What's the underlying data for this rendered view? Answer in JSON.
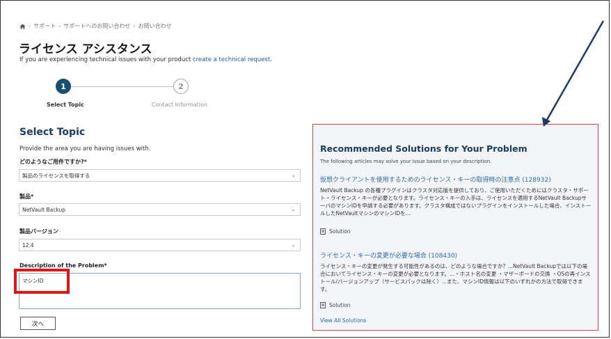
{
  "breadcrumb": {
    "home_icon": "home-icon",
    "items": [
      "サポート",
      "サポートへのお問い合わせ",
      "お問い合わせ"
    ],
    "separator": "›"
  },
  "page": {
    "title": "ライセンス アシスタンス",
    "subtitle_prefix": "If you are experiencing technical issues with your product ",
    "subtitle_link": "create a technical request",
    "subtitle_suffix": "."
  },
  "stepper": {
    "steps": [
      {
        "number": "1",
        "label": "Select Topic"
      },
      {
        "number": "2",
        "label": "Contact Information"
      }
    ]
  },
  "form": {
    "section_title": "Select Topic",
    "section_desc": "Provide the area you are having issues with.",
    "topic_label": "どのようなご用件ですか?*",
    "topic_value": "製品のライセンスを取得する",
    "product_label": "製品*",
    "product_value": "NetVault Backup",
    "version_label": "製品バージョン",
    "version_value": "12.4",
    "description_label": "Description of the Problem*",
    "description_value": "マシンID",
    "next_button": "次へ"
  },
  "recommended": {
    "title": "Recommended Solutions for Your Problem",
    "subtitle": "The following articles may solve your issue based on your description.",
    "articles": [
      {
        "title": "仮想クライアントを使用するためのライセンス・キーの取得時の注意点 (128932)",
        "body": "NetVault Backup の各種プラグインはクラスタ対応版を提供しており、ご使用いただくためにはクラスタ・サポート・ライセンス・キーが必要となります。ライセンス・キーの入手は、ライセンスを適用するNetVault BackupサーバのマシンIDを申請する必要があります。クラスタ構成ではないプラグインをインストールした場合、インストールしたNetVaultマシンのマシンIDを...",
        "type": "Solution"
      },
      {
        "title": "ライセンス・キーの変更が必要な場合 (108430)",
        "body": "ライセンス・キーの変更が発生する可能性があるのは、どのような場合ですか？...NetVault Backupでは以下の場合においてライセンス・キーの変更が必要となります。...・ホスト名の変更 ・マザーボードの交換 ・OSの再インストール/バージョンアップ（サービスパックは除く）...また、マシンID情報は以下のいずれかの方法で取得できます。",
        "type": "Solution"
      }
    ],
    "view_all": "View All Solutions"
  },
  "colors": {
    "accent": "#1a4f73",
    "link": "#2a6cb1",
    "highlight_box": "#e01515",
    "annotation_arrow": "#1f3a66"
  }
}
